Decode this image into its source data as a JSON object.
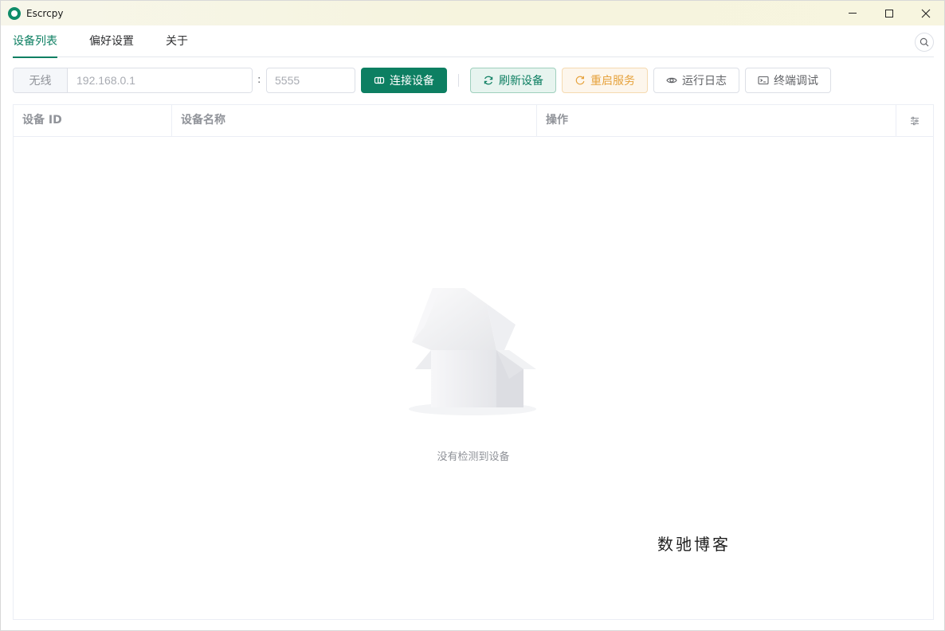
{
  "window": {
    "title": "Escrcpy",
    "controls": {
      "minimize": "minimize-icon",
      "maximize": "maximize-icon",
      "close": "close-icon"
    }
  },
  "tabs": [
    {
      "label": "设备列表",
      "active": true
    },
    {
      "label": "偏好设置",
      "active": false
    },
    {
      "label": "关于",
      "active": false
    }
  ],
  "toolbar": {
    "ip_prefix": "无线",
    "ip_placeholder": "192.168.0.1",
    "colon": ":",
    "port_placeholder": "5555",
    "connect_label": "连接设备",
    "refresh_label": "刷新设备",
    "restart_label": "重启服务",
    "log_label": "运行日志",
    "terminal_label": "终端调试"
  },
  "table": {
    "columns": [
      "设备 ID",
      "设备名称",
      "操作"
    ],
    "settings_icon": "column-settings-icon",
    "empty_text": "没有检测到设备"
  },
  "watermark": "数驰博客",
  "colors": {
    "accent": "#0d7f62",
    "warning": "#e6a23c",
    "muted": "#909399"
  }
}
